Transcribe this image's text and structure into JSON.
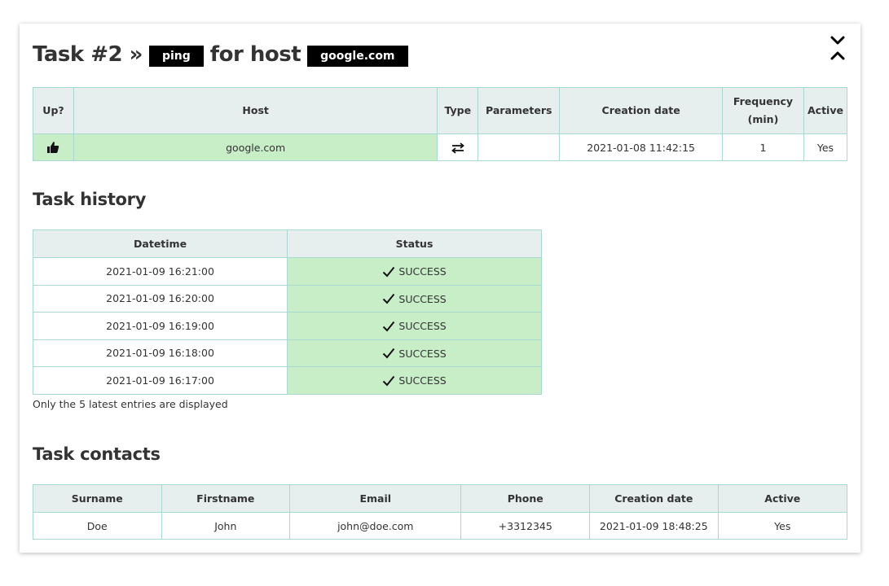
{
  "header": {
    "title_prefix": "Task #2 »",
    "task_type": "ping",
    "title_middle": "for host",
    "host": "google.com",
    "toggle_icon": "collapse-expand-chevrons-icon"
  },
  "task_table": {
    "columns": [
      "Up?",
      "Host",
      "Type",
      "Parameters",
      "Creation date",
      "Frequency (min)",
      "Active"
    ],
    "row": {
      "up_icon": "thumbs-up-icon",
      "host": "google.com",
      "type_icon": "exchange-arrows-icon",
      "parameters": "",
      "creation_date": "2021-01-08 11:42:15",
      "frequency": "1",
      "active": "Yes"
    }
  },
  "history": {
    "title": "Task history",
    "columns": [
      "Datetime",
      "Status"
    ],
    "rows": [
      {
        "datetime": "2021-01-09 16:21:00",
        "status": "SUCCESS"
      },
      {
        "datetime": "2021-01-09 16:20:00",
        "status": "SUCCESS"
      },
      {
        "datetime": "2021-01-09 16:19:00",
        "status": "SUCCESS"
      },
      {
        "datetime": "2021-01-09 16:18:00",
        "status": "SUCCESS"
      },
      {
        "datetime": "2021-01-09 16:17:00",
        "status": "SUCCESS"
      }
    ],
    "note": "Only the 5 latest entries are displayed"
  },
  "contacts": {
    "title": "Task contacts",
    "columns": [
      "Surname",
      "Firstname",
      "Email",
      "Phone",
      "Creation date",
      "Active"
    ],
    "rows": [
      {
        "surname": "Doe",
        "firstname": "John",
        "email": "john@doe.com",
        "phone": "+3312345",
        "creation_date": "2021-01-09 18:48:25",
        "active": "Yes"
      }
    ]
  },
  "colors": {
    "header_bg": "#e6eeee",
    "border": "#a8d8d0",
    "success_bg": "#c8eec8",
    "badge_bg": "#000000"
  }
}
